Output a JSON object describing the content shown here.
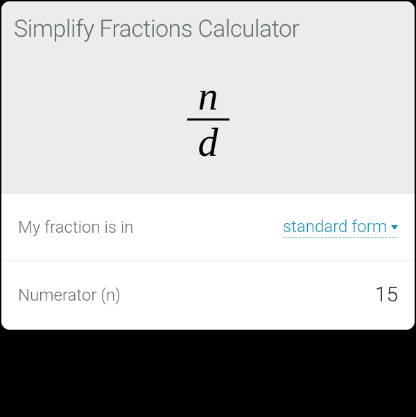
{
  "header": {
    "title": "Simplify Fractions Calculator"
  },
  "formula": {
    "numerator_symbol": "n",
    "denominator_symbol": "d"
  },
  "fields": {
    "form_label": "My fraction is in",
    "form_value": "standard form",
    "numerator_label": "Numerator (n)",
    "numerator_value": "15"
  },
  "colors": {
    "header_bg": "#ececec",
    "text_muted": "#5f6b72",
    "link": "#1a8fb4"
  }
}
